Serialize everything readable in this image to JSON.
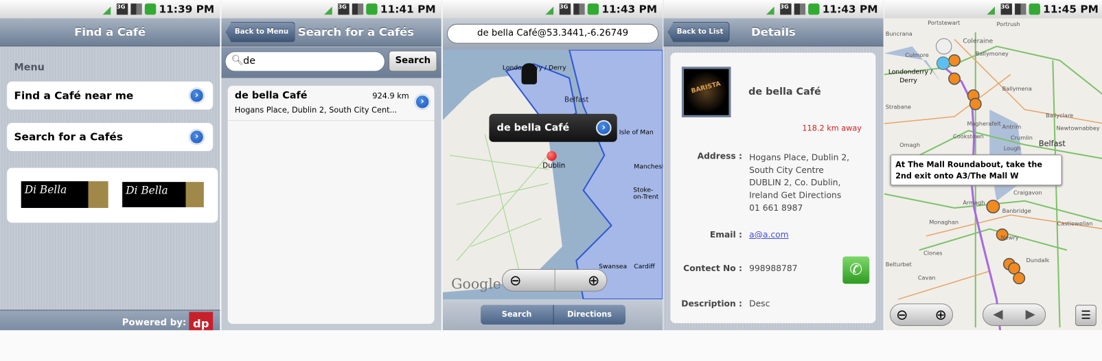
{
  "screens": [
    {
      "time": "11:39 PM",
      "title": "Find a Café",
      "menu_label": "Menu",
      "items": [
        {
          "label": "Find a Café near me"
        },
        {
          "label": "Search for a Cafés"
        }
      ],
      "logos": [
        "Di Bella COFFEE",
        "Di Bella COFFEE"
      ],
      "footer": "Powered by:",
      "footer_logo": "dp"
    },
    {
      "time": "11:41 PM",
      "title": "Search for a Cafés",
      "back": "Back to Menu",
      "search_value": "de",
      "search_button": "Search",
      "results": [
        {
          "name": "de bella Café",
          "distance": "924.9 km",
          "address": "Hogans Place, Dublin 2, South City Cent..."
        }
      ]
    },
    {
      "time": "11:43 PM",
      "address_bar": "de bella Café@53.3441,-6.26749",
      "callout": "de bella Café",
      "labels": [
        "Londonderry / Derry",
        "Belfast",
        "Dublin",
        "Isle of Man",
        "Manchester",
        "Stoke-on-Trent",
        "Swansea",
        "Cardiff"
      ],
      "google": "Google",
      "tabs": [
        "Search",
        "Directions"
      ]
    },
    {
      "time": "11:43 PM",
      "title": "Details",
      "back": "Back to List",
      "name": "de bella Café",
      "image_text": "BARISTA",
      "distance": "118.2 km away",
      "address_label": "Address :",
      "address_lines": [
        "Hogans Place, Dublin 2,",
        "South City Centre",
        "DUBLIN 2, Co. Dublin,",
        "Ireland  Get Directions",
        "01 661 8987"
      ],
      "email_label": "Email :",
      "email": "a@a.com",
      "contact_label": "Contect No :",
      "contact": "998988787",
      "desc_label": "Description :",
      "desc": "Desc"
    },
    {
      "time": "11:45 PM",
      "instruction": "At The Mall Roundabout, take the 2nd exit onto A3/The Mall W",
      "labels": [
        "Portstewart",
        "Portrush",
        "Buncrana",
        "Coleraine",
        "Culmore",
        "Ballymoney",
        "Londonderry /",
        "Derry",
        "Ballymena",
        "Strabane",
        "Magherafelt",
        "Ballyclare",
        "Antrim",
        "Newtownabbey",
        "Cookstown",
        "Crumlin",
        "Belfast",
        "Omagh",
        "Lough",
        "Craigavon",
        "Armagh",
        "Banbridge",
        "Monaghan",
        "Castlewellan",
        "Newry",
        "Clones",
        "Belturbet",
        "Dundalk",
        "Cavan"
      ]
    }
  ],
  "colors": {
    "accent": "#1b55b8",
    "header": "#6d7f96",
    "distance_red": "#d42020",
    "route": "#a66be0"
  }
}
